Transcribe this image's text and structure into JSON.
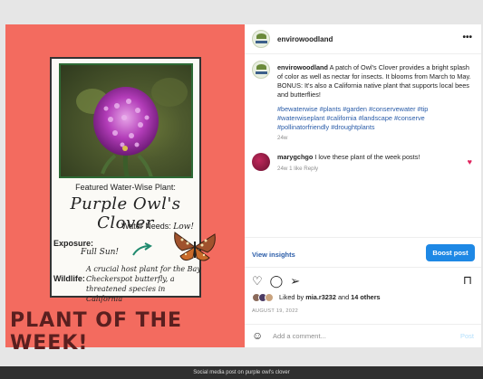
{
  "colors": {
    "accent": "#1e88e5",
    "link": "#2a5ca8",
    "heart": "#e0245e",
    "poster_bg": "#f36b5f"
  },
  "poster": {
    "featured": "Featured Water-Wise Plant:",
    "plant_name": "Purple Owl's Clover",
    "water_label": "Water Needs:",
    "water_value": "Low!",
    "exposure_label": "Exposure:",
    "exposure_value": "Full Sun!",
    "wildlife_label": "Wildlife:",
    "wildlife_text": "A crucial host plant for the Bay Checkerspot butterfly, a threatened species in California",
    "banner": "PLANT OF THE WEEK!"
  },
  "header": {
    "username": "envirowoodland",
    "more_icon": "more-horizontal-icon"
  },
  "caption": {
    "username": "envirowoodland",
    "text": "A patch of Owl's Clover provides a bright splash of color as well as nectar for insects. It blooms from March to May. BONUS: It's also a California native plant that supports local bees and butterflies!",
    "hashtags": "#bewaterwise #plants #garden #conservewater #tip #waterwiseplant #california #landscape #conserve #pollinatorfriendly #droughtplants",
    "time": "24w"
  },
  "comment": {
    "username": "marygchgo",
    "text": "I love these plant of the week posts!",
    "meta": "24w  1 like  Reply"
  },
  "actions": {
    "insights": "View insights",
    "boost": "Boost post"
  },
  "likes": {
    "prefix": "Liked by ",
    "user": "mia.r3232",
    "mid": " and ",
    "count": "14 others"
  },
  "date": "AUGUST 19, 2022",
  "add_comment": {
    "placeholder": "Add a comment...",
    "post": "Post"
  },
  "footer": "Social media post on purple owl's clover"
}
